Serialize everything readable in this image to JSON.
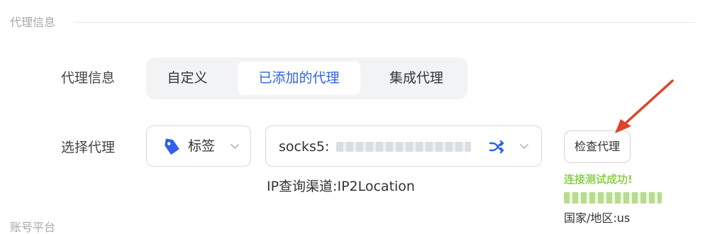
{
  "section": {
    "title": "代理信息"
  },
  "proxy_info": {
    "label": "代理信息",
    "tabs": [
      {
        "label": "自定义"
      },
      {
        "label": "已添加的代理"
      },
      {
        "label": "集成代理"
      }
    ]
  },
  "select_proxy": {
    "label": "选择代理",
    "tag_select": {
      "label": "标签",
      "icon": "tag-icon"
    },
    "proxy_select": {
      "value": "socks5:",
      "masked_address": "████████████",
      "icons": [
        "shuffle-icon",
        "chevron-down-icon"
      ]
    },
    "check_button": {
      "label": "检查代理"
    },
    "ip_channel": "IP查询渠道:IP2Location"
  },
  "check_result": {
    "success": "连接测试成功!",
    "ip_masked": "██████████",
    "country_line": "国家/地区:us"
  },
  "bottom_section": {
    "title": "账号平台"
  },
  "colors": {
    "accent": "#2f62e8",
    "success": "#8fd14f",
    "annotation_arrow": "#d9462b",
    "tab_background": "#f2f3f5",
    "divider": "#e6e6e6"
  }
}
